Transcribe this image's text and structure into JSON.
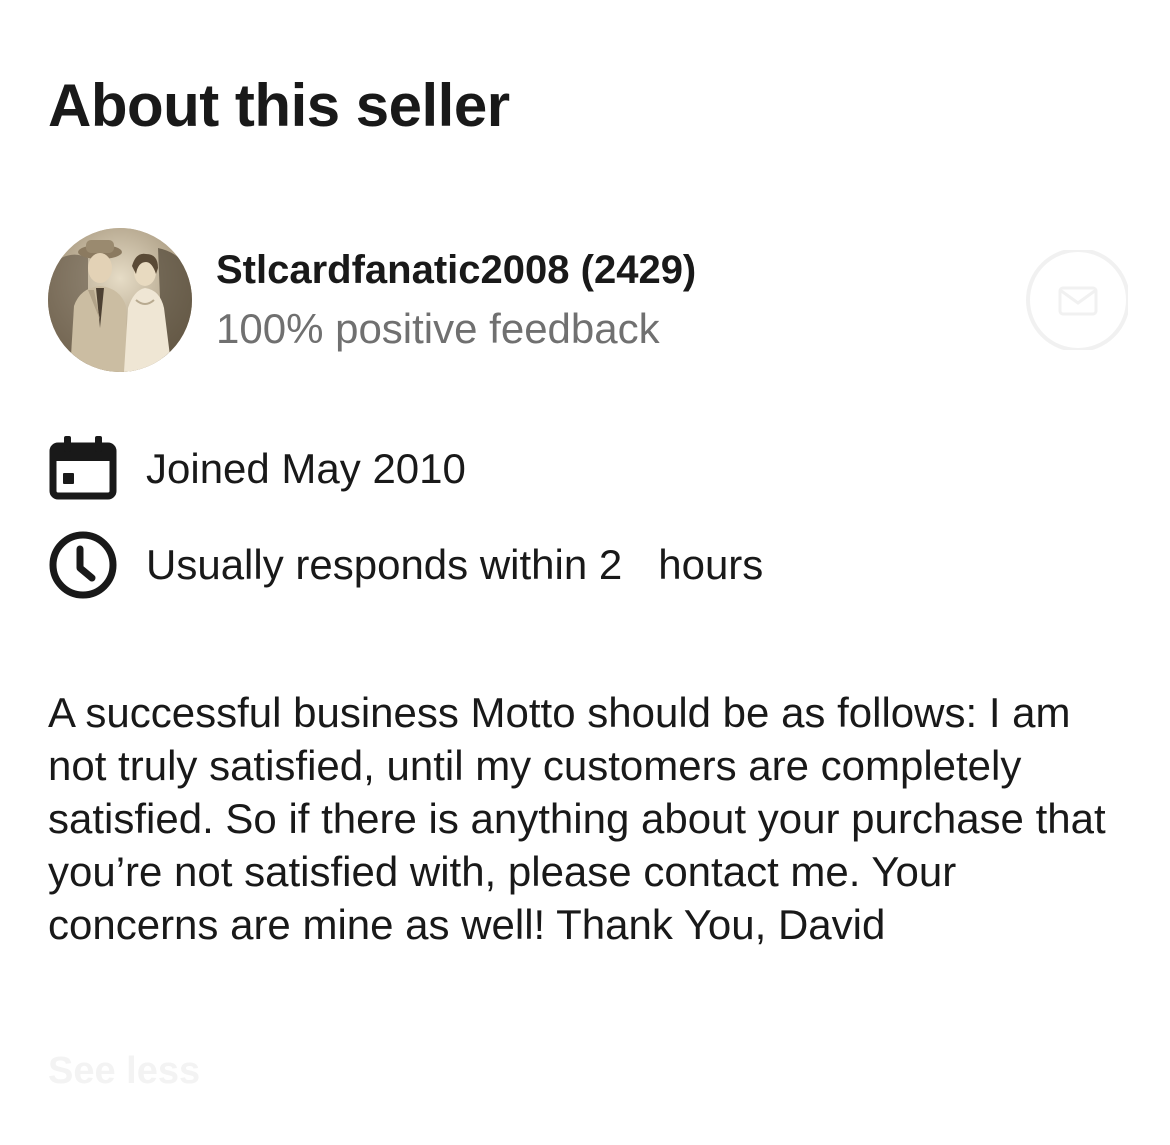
{
  "section": {
    "title": "About this seller"
  },
  "seller": {
    "name_with_score": "Stlcardfanatic2008 (2429)",
    "feedback": "100% positive feedback",
    "avatar": "vintage couple photo"
  },
  "details": {
    "joined": "Joined May 2010",
    "response_prefix": "Usually responds within 2",
    "response_suffix": "hours",
    "calendar_icon": "calendar-icon",
    "clock_icon": "clock-icon"
  },
  "description": "A successful business Motto should be as follows: I am not truly satisfied, until my customers are completely satisfied. So if there is anything about your purchase that you’re not satisfied with, please contact me. Your concerns are mine as well! Thank You, David",
  "actions": {
    "contact_icon": "message-icon",
    "see_less_label": "See less"
  },
  "colors": {
    "text_primary": "#191919",
    "text_secondary": "#707070",
    "background": "#ffffff"
  }
}
